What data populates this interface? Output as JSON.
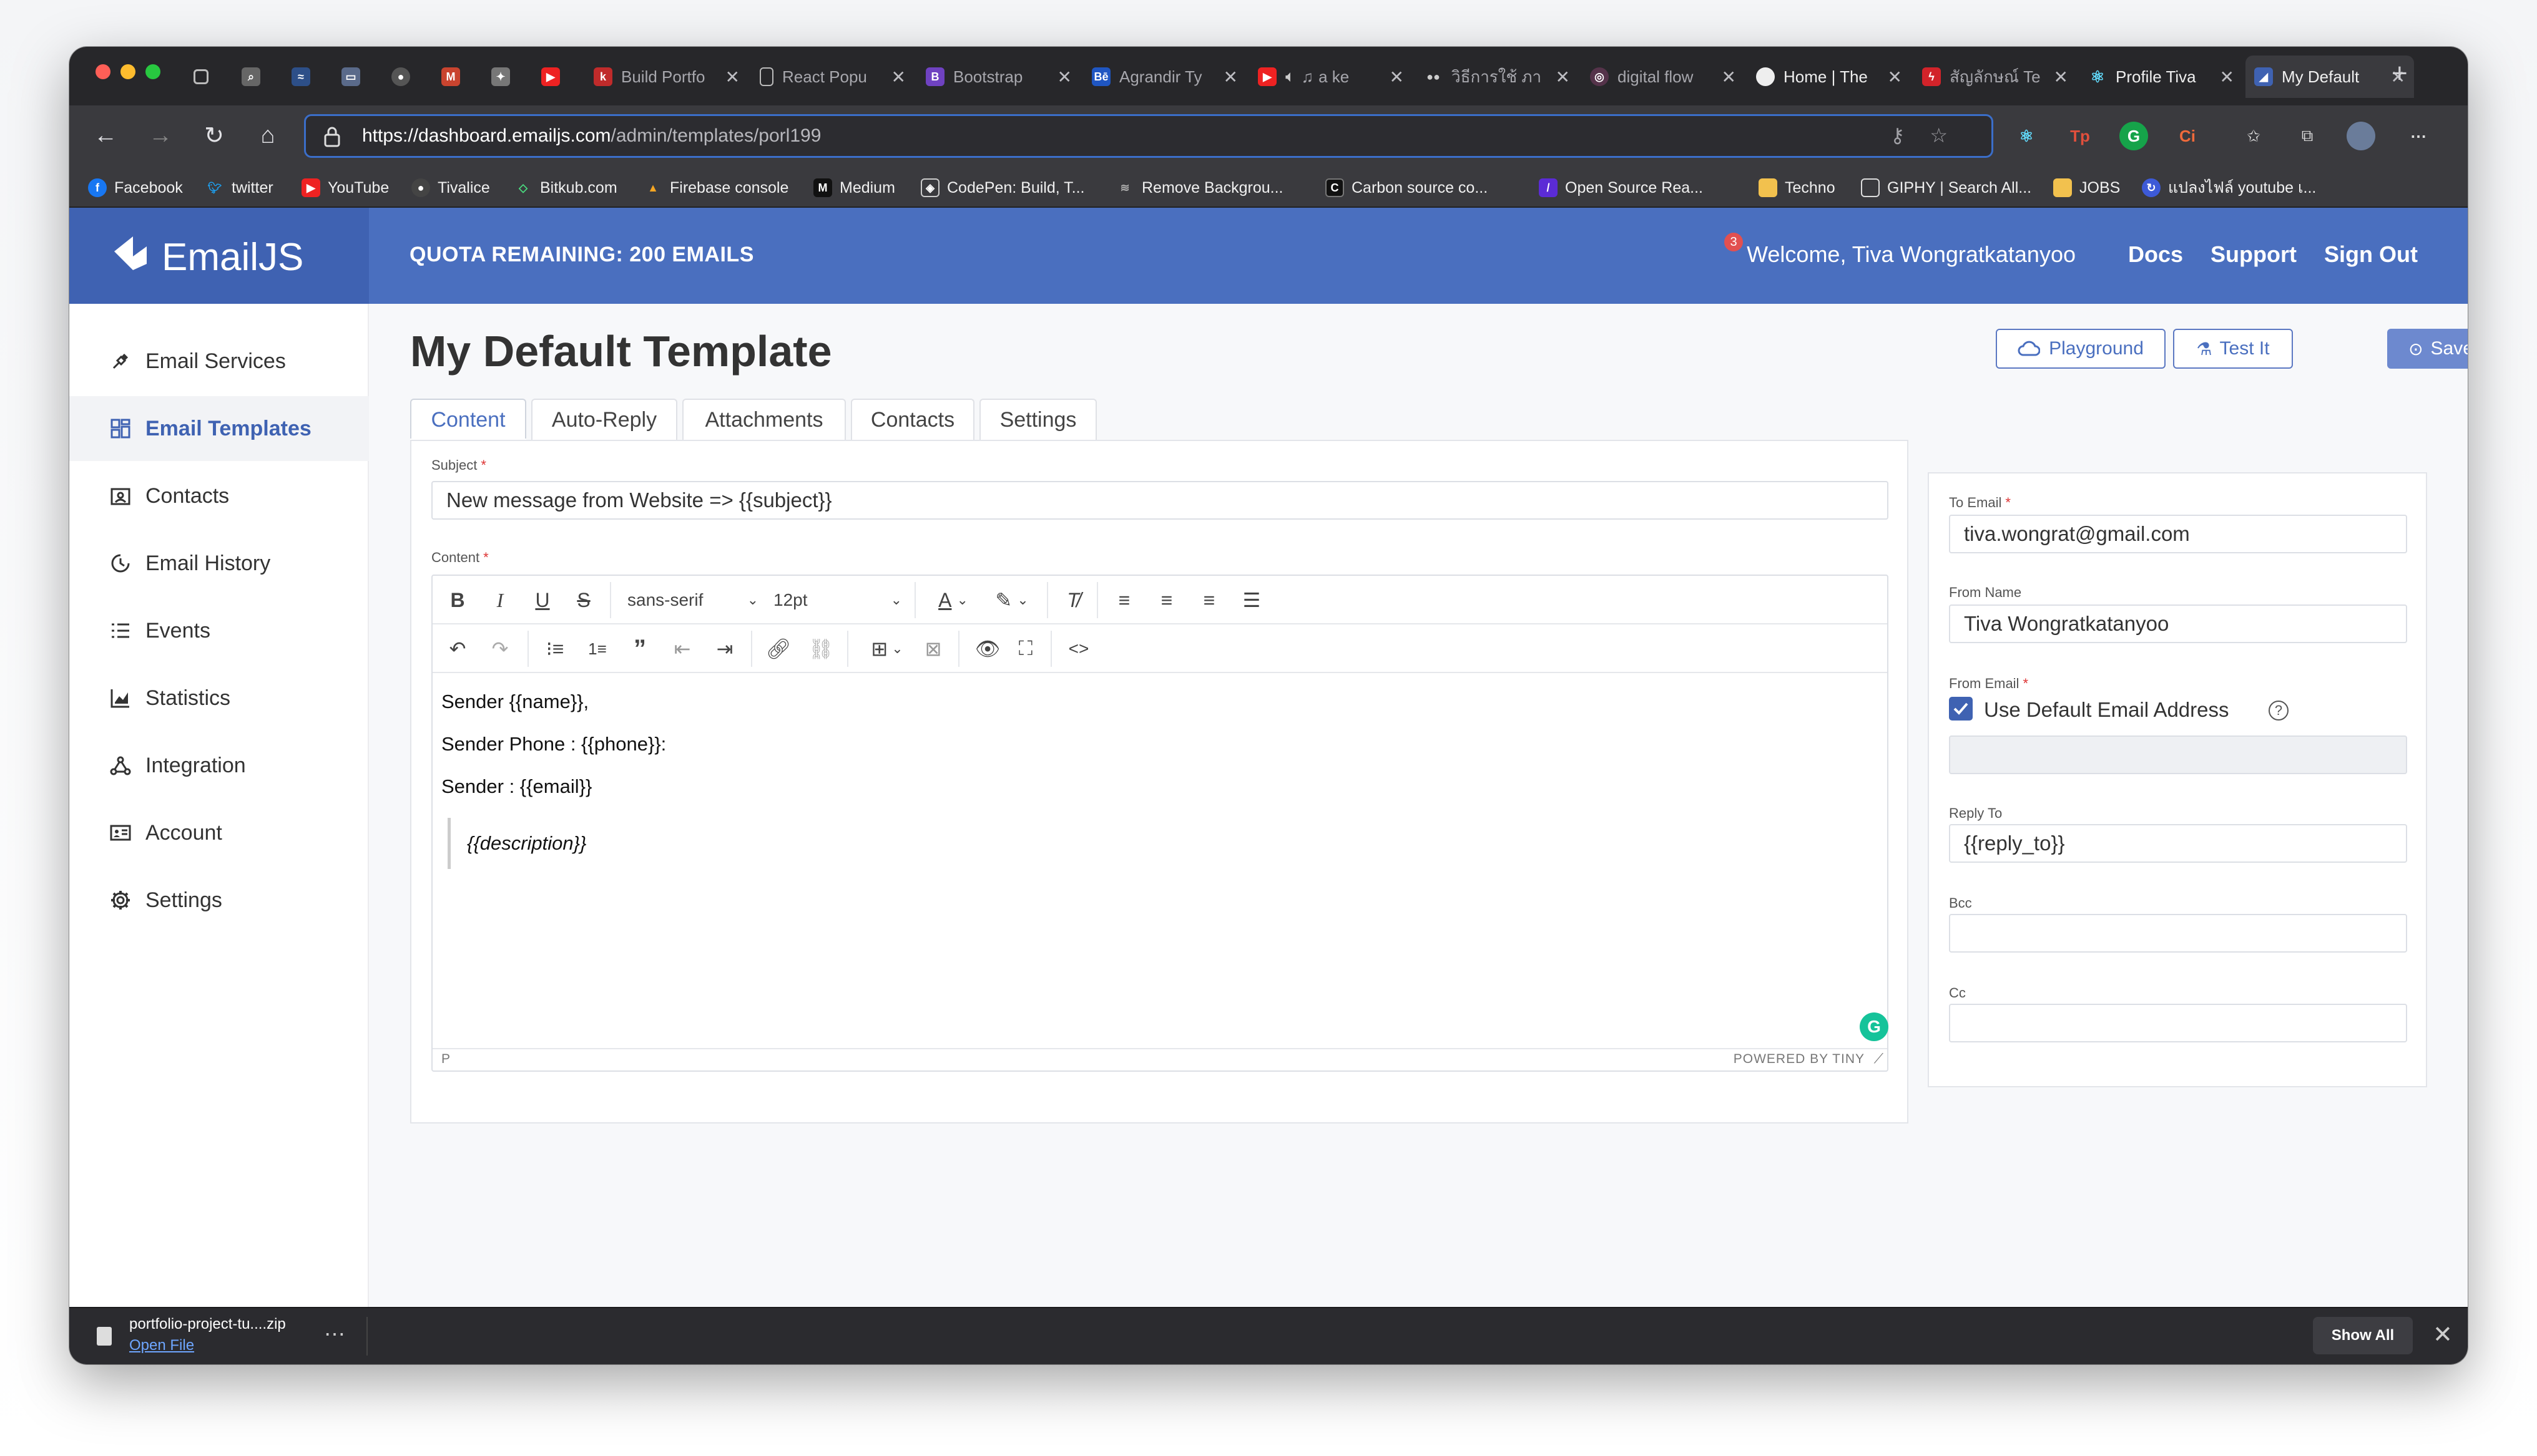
{
  "browser": {
    "tabs": [
      {
        "title": "",
        "icon": "sidebar-icon"
      },
      {
        "title": "",
        "icon": "search-icon"
      },
      {
        "title": "",
        "icon": "app-icon"
      },
      {
        "title": "",
        "icon": "card-icon"
      },
      {
        "title": "",
        "icon": "github-icon"
      },
      {
        "title": "",
        "icon": "gmail-icon"
      },
      {
        "title": "",
        "icon": "pin-icon"
      },
      {
        "title": "",
        "icon": "youtube-icon"
      },
      {
        "title": "Build Portfo",
        "icon": "k-icon"
      },
      {
        "title": "React Popu",
        "icon": "doc-icon"
      },
      {
        "title": "Bootstrap",
        "icon": "bootstrap-icon"
      },
      {
        "title": "Agrandir Ty",
        "icon": "ba-icon"
      },
      {
        "title": "a ke",
        "icon": "youtube-icon"
      },
      {
        "title": "วิธีการใช้ ภา",
        "icon": "dots-icon"
      },
      {
        "title": "digital flow",
        "icon": "circle-icon"
      },
      {
        "title": "Home | The",
        "icon": "circle-icon"
      },
      {
        "title": "สัญลักษณ์ Te",
        "icon": "bolt-icon"
      },
      {
        "title": "Profile Tiva",
        "icon": "react-icon"
      },
      {
        "title": "My Default",
        "icon": "emailjs-icon"
      }
    ],
    "url_host": "https://dashboard.emailjs.com",
    "url_path": "/admin/templates/porl199",
    "bookmarks": [
      "Facebook",
      "twitter",
      "YouTube",
      "Tivalice",
      "Bitkub.com",
      "Firebase console",
      "Medium",
      "CodePen: Build, T...",
      "Remove Backgrou...",
      "Carbon source co...",
      "Open Source Rea...",
      "Techno",
      "GIPHY | Search All...",
      "JOBS",
      "แปลงไฟล์ youtube เ..."
    ]
  },
  "app": {
    "brand": "EmailJS",
    "quota": "QUOTA REMAINING: 200 EMAILS",
    "welcome": "Welcome,  Tiva Wongratkatanyoo",
    "notif_count": "3",
    "nav_docs": "Docs",
    "nav_support": "Support",
    "nav_signout": "Sign Out"
  },
  "sidebar": {
    "items": [
      {
        "label": "Email Services",
        "icon": "plug-icon"
      },
      {
        "label": "Email Templates",
        "icon": "templates-icon"
      },
      {
        "label": "Contacts",
        "icon": "contacts-icon"
      },
      {
        "label": "Email History",
        "icon": "history-icon"
      },
      {
        "label": "Events",
        "icon": "list-icon"
      },
      {
        "label": "Statistics",
        "icon": "chart-icon"
      },
      {
        "label": "Integration",
        "icon": "integration-icon"
      },
      {
        "label": "Account",
        "icon": "account-icon"
      },
      {
        "label": "Settings",
        "icon": "gear-icon"
      }
    ]
  },
  "page": {
    "title": "My Default Template",
    "playground": "Playground",
    "test_it": "Test It",
    "save": "Save",
    "tabs": [
      "Content",
      "Auto-Reply",
      "Attachments",
      "Contacts",
      "Settings"
    ]
  },
  "form": {
    "subject_label": "Subject",
    "subject_value": "New message from Website => {{subject}}",
    "content_label": "Content",
    "font_family": "sans-serif",
    "font_size": "12pt",
    "body_lines": [
      "Sender {{name}},",
      "Sender Phone : {{phone}}:",
      "Sender : {{email}}"
    ],
    "body_quote": "{{description}}",
    "status_path": "P",
    "powered_by": "POWERED BY TINY"
  },
  "side_form": {
    "to_email_label": "To Email",
    "to_email_value": "tiva.wongrat@gmail.com",
    "from_name_label": "From Name",
    "from_name_value": "Tiva Wongratkatanyoo",
    "from_email_label": "From Email",
    "use_default_label": "Use Default Email Address",
    "use_default_checked": true,
    "reply_to_label": "Reply To",
    "reply_to_value": "{{reply_to}}",
    "bcc_label": "Bcc",
    "bcc_value": "",
    "cc_label": "Cc",
    "cc_value": ""
  },
  "download": {
    "file": "portfolio-project-tu....zip",
    "open_file": "Open File",
    "show_all": "Show All"
  },
  "colors": {
    "brand": "#4a6fbf",
    "brand_dark": "#3f62b2",
    "chrome": "#27272a"
  }
}
